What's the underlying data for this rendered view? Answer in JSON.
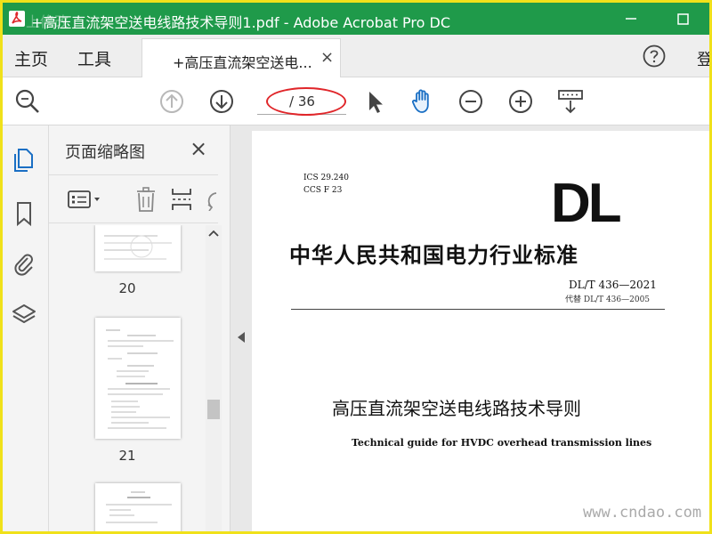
{
  "window": {
    "title": "+高压直流架空送电线路技术导则1.pdf - Adobe Acrobat Pro DC",
    "ghost_text": "上修改",
    "app_icon": "acrobat-icon",
    "accent": "#1f9a4a",
    "frame_color": "#f0e11a"
  },
  "menu": {
    "home": "主页",
    "tools": "工具",
    "login": "登"
  },
  "tab": {
    "label": "+高压直流架空送电...",
    "close": "×"
  },
  "toolbar": {
    "current_page": "",
    "page_total": "/ 36",
    "annotation_color": "#e0262a"
  },
  "thumbnails": {
    "title": "页面缩略图",
    "close": "×",
    "pages": [
      {
        "number": "20"
      },
      {
        "number": "21"
      }
    ]
  },
  "document": {
    "ics": "ICS 29.240",
    "ccs": "CCS F 23",
    "logo": "DL",
    "title_cn": "中华人民共和国电力行业标准",
    "std_number": "DL/T  436—2021",
    "replaces": "代替 DL/T  436—2005",
    "subtitle_cn": "高压直流架空送电线路技术导则",
    "subtitle_en": "Technical guide for HVDC overhead transmission lines"
  },
  "watermark": "www.cndao.com"
}
